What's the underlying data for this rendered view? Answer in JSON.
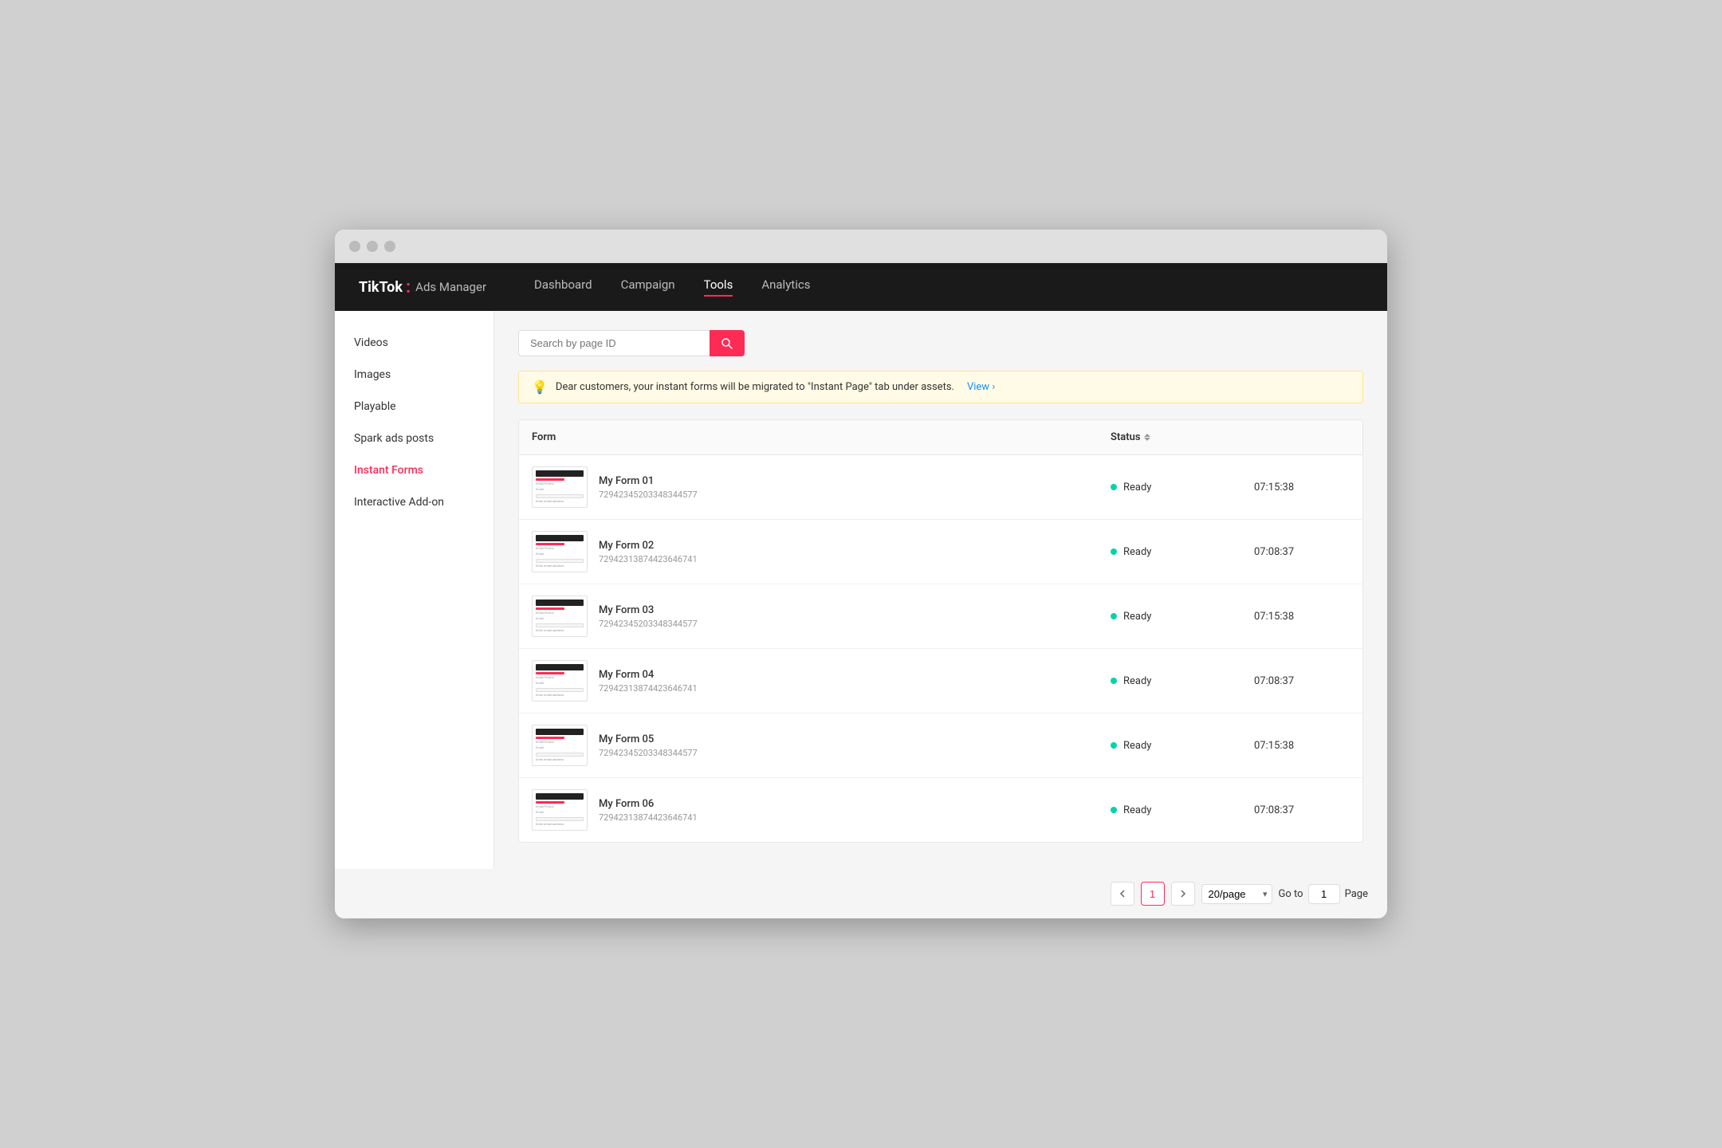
{
  "window": {
    "title": "TikTok Ads Manager"
  },
  "logo": {
    "brand": "TikTok",
    "dot": ":",
    "subtitle": "Ads Manager"
  },
  "topnav": {
    "links": [
      {
        "label": "Dashboard",
        "active": false
      },
      {
        "label": "Campaign",
        "active": false
      },
      {
        "label": "Tools",
        "active": true
      },
      {
        "label": "Analytics",
        "active": false
      }
    ]
  },
  "sidebar": {
    "items": [
      {
        "label": "Videos",
        "active": false
      },
      {
        "label": "Images",
        "active": false
      },
      {
        "label": "Playable",
        "active": false
      },
      {
        "label": "Spark ads posts",
        "active": false
      },
      {
        "label": "Instant Forms",
        "active": true
      },
      {
        "label": "Interactive Add-on",
        "active": false
      }
    ]
  },
  "search": {
    "placeholder": "Search by page ID"
  },
  "notice": {
    "text": "Dear customers,  your instant forms will be migrated to \"Instant Page\" tab under assets.",
    "link_text": "View",
    "chevron": "›"
  },
  "table": {
    "headers": {
      "form": "Form",
      "status": "Status",
      "time": ""
    },
    "rows": [
      {
        "name": "My Form 01",
        "id": "72942345203348344577",
        "status": "Ready",
        "time": "07:15:38"
      },
      {
        "name": "My Form 02",
        "id": "72942313874423646741",
        "status": "Ready",
        "time": "07:08:37"
      },
      {
        "name": "My Form 03",
        "id": "72942345203348344577",
        "status": "Ready",
        "time": "07:15:38"
      },
      {
        "name": "My Form 04",
        "id": "72942313874423646741",
        "status": "Ready",
        "time": "07:08:37"
      },
      {
        "name": "My Form 05",
        "id": "72942345203348344577",
        "status": "Ready",
        "time": "07:15:38"
      },
      {
        "name": "My Form 06",
        "id": "72942313874423646741",
        "status": "Ready",
        "time": "07:08:37"
      }
    ]
  },
  "pagination": {
    "current_page": "1",
    "per_page": "20/page",
    "goto_label": "Go to",
    "page_label": "Page",
    "goto_value": "1"
  }
}
